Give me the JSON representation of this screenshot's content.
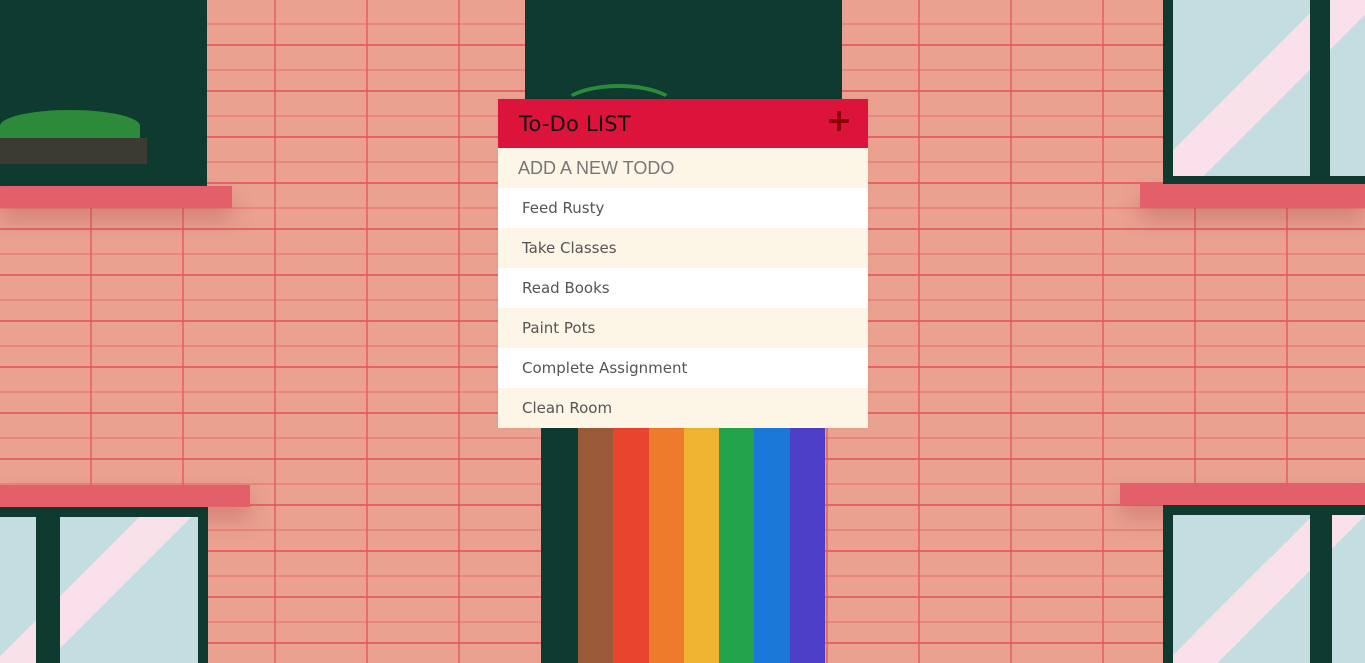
{
  "app": {
    "title": "To-Do LIST",
    "add_icon": "plus-icon"
  },
  "input": {
    "placeholder": "ADD A NEW TODO",
    "value": ""
  },
  "todos": [
    {
      "text": "Feed Rusty"
    },
    {
      "text": "Take Classes"
    },
    {
      "text": "Read Books"
    },
    {
      "text": "Paint Pots"
    },
    {
      "text": "Complete Assignment"
    },
    {
      "text": "Clean Room"
    }
  ],
  "colors": {
    "header": "#dc143c",
    "add_icon": "#8b0000",
    "row_alt": "#fdf5e6",
    "row": "#ffffff",
    "text": "#555555"
  },
  "background": {
    "rainbow": [
      "#9a5a3a",
      "#e8442e",
      "#ee7a2c",
      "#f0b432",
      "#22a34a",
      "#1b78d8",
      "#4d3fc7"
    ]
  }
}
